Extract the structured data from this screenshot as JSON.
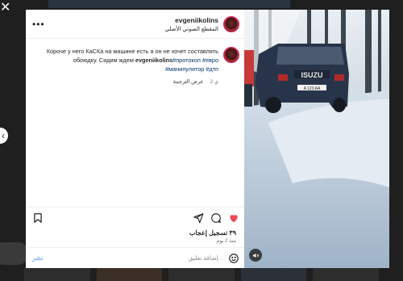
{
  "post": {
    "username": "evgeniikolins",
    "audio_label": "المقطع الصوتي الأصلي",
    "caption": {
      "username": "evgeniikolins",
      "text": " Короче у него КаСКа на машине есть а он не хочет составлять обоюдку. Сидим ждем",
      "hashtags": [
        "#протокол",
        "#евро",
        "#манипулятор",
        "#дтп"
      ]
    },
    "age_short": "2 ي",
    "see_translation": "عرض الترجمة",
    "likes": "٣٩ تسجيل إعجاب",
    "posted_ago": "منذ 2 يوم",
    "comment_placeholder": "إضافة تعليق...",
    "post_button": "نشر",
    "plate": "A 123 AA",
    "brand_text": "ISUZU"
  },
  "icons": {
    "close": "close-icon",
    "more": "more-options-icon",
    "like": "heart-icon",
    "comment": "comment-icon",
    "share": "send-icon",
    "save": "bookmark-icon",
    "emoji": "emoji-icon",
    "mute": "mute-icon",
    "prev": "chevron-left-icon"
  },
  "colors": {
    "like_active": "#ed4956",
    "link": "#00376b",
    "post_disabled": "#85b8f5"
  }
}
